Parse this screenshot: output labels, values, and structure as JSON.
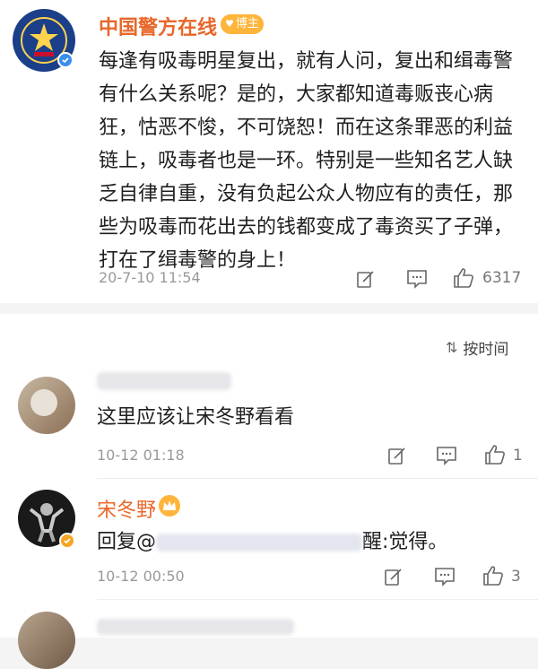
{
  "post": {
    "author": "中国警方在线",
    "badge": "博主",
    "content": "每逢有吸毒明星复出，就有人问，复出和缉毒警有什么关系呢？是的，大家都知道毒贩丧心病狂，怙恶不悛，不可饶恕！而在这条罪恶的利益链上，吸毒者也是一环。特别是一些知名艺人缺乏自律自重，没有负起公众人物应有的责任，那些为吸毒而花出去的钱都变成了毒资买了子弹，打在了缉毒警的身上！",
    "time": "20-7-10 11:54",
    "likes": "6317"
  },
  "sort": {
    "label": "按时间"
  },
  "comments": [
    {
      "author": "",
      "text": "这里应该让宋冬野看看",
      "time": "10-12 01:18",
      "likes": "1"
    },
    {
      "author": "宋冬野",
      "reply_prefix": "回复",
      "reply_suffix": "醒:觉得。",
      "time": "10-12 00:50",
      "likes": "3"
    }
  ],
  "colors": {
    "brand_orange": "#e8672a",
    "verify_blue": "#3b8ef0",
    "verify_gold": "#f5a623"
  }
}
